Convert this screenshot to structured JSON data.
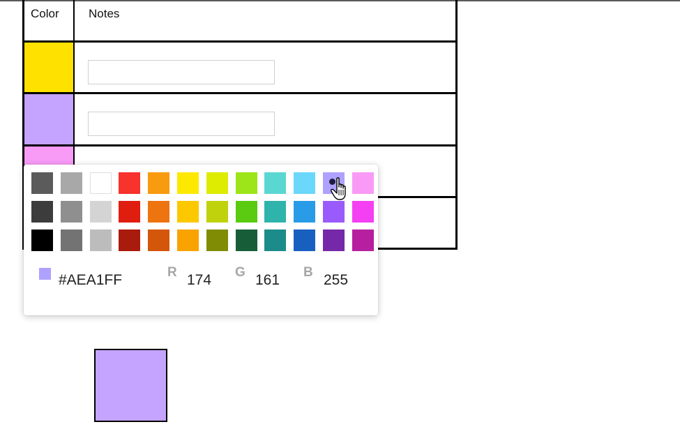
{
  "table": {
    "headers": {
      "color": "Color",
      "notes": "Notes"
    },
    "rows": [
      {
        "color": "#FFE100",
        "note": ""
      },
      {
        "color": "#C4A4FF",
        "note": ""
      },
      {
        "color": "#F79BF7",
        "note": ""
      },
      {
        "color": "#FFFFFF",
        "note": ""
      }
    ]
  },
  "picker": {
    "palette": [
      [
        "#5b5b5b",
        "#a8a8a8",
        "#ffffff",
        "#f8322c",
        "#f99b0e",
        "#fde900",
        "#ddec00",
        "#9de418",
        "#5bd7d2",
        "#6ad7fb",
        "#aea1ff",
        "#f99af6"
      ],
      [
        "#3c3c3c",
        "#8f8f8f",
        "#d4d4d4",
        "#e01e10",
        "#ee7410",
        "#fdc800",
        "#bfd20c",
        "#5acb10",
        "#2eb4ab",
        "#2a9be6",
        "#9a5bfc",
        "#f43ff2"
      ],
      [
        "#000000",
        "#737373",
        "#bcbcbc",
        "#a91b0c",
        "#d4560b",
        "#f9a300",
        "#808d04",
        "#175e38",
        "#1c8c8a",
        "#1760c0",
        "#7528a8",
        "#b61f9f"
      ]
    ],
    "selected": {
      "row": 0,
      "col": 10
    },
    "current": {
      "hex": "#AEA1FF",
      "r": "174",
      "g": "161",
      "b": "255",
      "r_label": "R",
      "g_label": "G",
      "b_label": "B"
    }
  },
  "preview": {
    "color": "#C4A4FF"
  }
}
